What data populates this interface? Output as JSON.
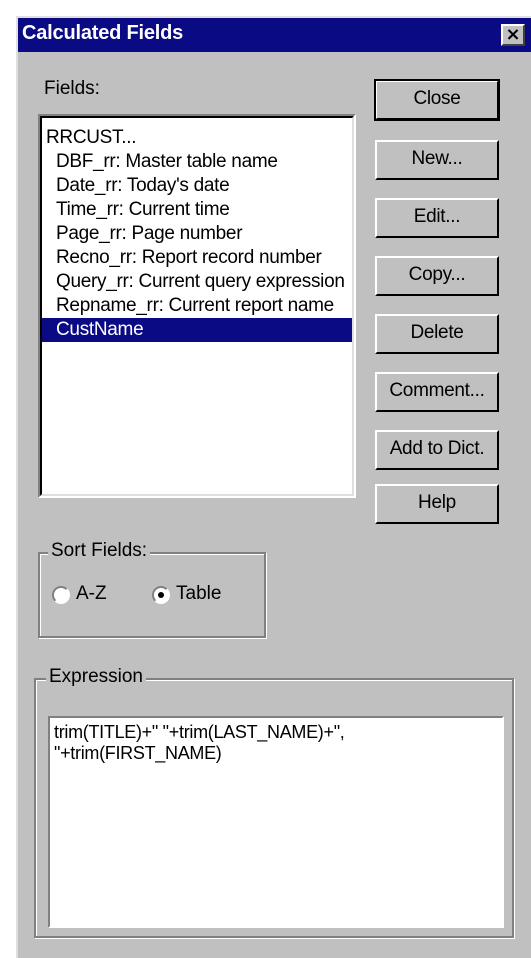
{
  "dialog": {
    "title": "Calculated Fields",
    "close_glyph": "×"
  },
  "fields_label": "Fields:",
  "fields": [
    {
      "label": "RRCUST...",
      "indent": false,
      "selected": false
    },
    {
      "label": "DBF_rr: Master table name",
      "indent": true,
      "selected": false
    },
    {
      "label": "Date_rr: Today's date",
      "indent": true,
      "selected": false
    },
    {
      "label": "Time_rr: Current time",
      "indent": true,
      "selected": false
    },
    {
      "label": "Page_rr: Page number",
      "indent": true,
      "selected": false
    },
    {
      "label": "Recno_rr: Report record number",
      "indent": true,
      "selected": false
    },
    {
      "label": "Query_rr: Current query expression",
      "indent": true,
      "selected": false
    },
    {
      "label": "Repname_rr: Current report name",
      "indent": true,
      "selected": false
    },
    {
      "label": "CustName",
      "indent": true,
      "selected": true
    }
  ],
  "buttons": {
    "close": "Close",
    "new": "New...",
    "edit": "Edit...",
    "copy": "Copy...",
    "delete": "Delete",
    "comment": "Comment...",
    "add_to_dict": "Add to Dict.",
    "help": "Help"
  },
  "sort_fields": {
    "label": "Sort Fields:",
    "options": [
      "A-Z",
      "Table"
    ],
    "selected": "Table"
  },
  "expression": {
    "label": "Expression",
    "value": "trim(TITLE)+\" \"+trim(LAST_NAME)+\",\n\"+trim(FIRST_NAME)"
  },
  "colors": {
    "face": "#c0c0c0",
    "titlebar": "#0a0a84",
    "selection": "#0a0a84"
  }
}
